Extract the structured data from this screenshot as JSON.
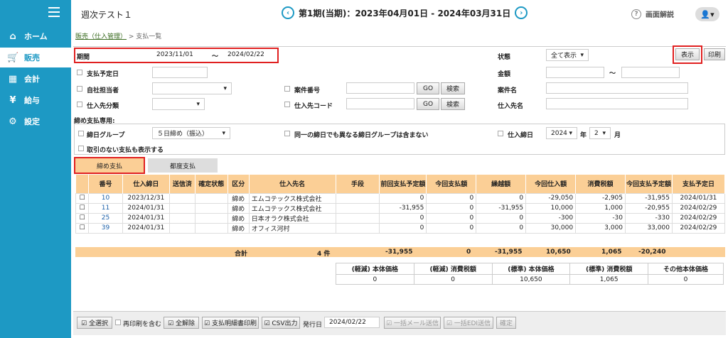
{
  "app": {
    "title": "週次テスト１"
  },
  "header": {
    "period": "第1期(当期)：2023年04月01日 - 2024年03月31日",
    "help": "画面解説",
    "prev": "‹",
    "next": "›"
  },
  "sidebar": {
    "items": [
      {
        "label": "ホーム",
        "icon": "⌂"
      },
      {
        "label": "販売",
        "icon": "🛒"
      },
      {
        "label": "会計",
        "icon": "▦"
      },
      {
        "label": "給与",
        "icon": "¥"
      },
      {
        "label": "設定",
        "icon": "⚙"
      }
    ]
  },
  "breadcrumb": {
    "parent": "販売（仕入管理）",
    "current": "> 支払一覧"
  },
  "filters": {
    "period_label": "期間",
    "date_from": "2023/11/01",
    "tilde": "〜",
    "date_to": "2024/02/22",
    "status_label": "状態",
    "status_value": "全て表示",
    "show_button": "表示",
    "print_button": "印刷",
    "pay_date_label": "支払予定日",
    "amount_label": "金額",
    "staff_label": "自社担当者",
    "case_no_label": "案件番号",
    "go": "GO",
    "search": "検索",
    "case_name_label": "案件名",
    "supplier_class_label": "仕入先分類",
    "supplier_code_label": "仕入先コード",
    "supplier_name_label": "仕入先名",
    "closing_only_label": "締め支払専用:",
    "closing_group_label": "締日グループ",
    "closing_group_value": "５日締め（振込）",
    "exclude_label": "同一の締日でも異なる締日グループは含まない",
    "closing_date_label": "仕入締日",
    "year_value": "2024",
    "year_unit": "年",
    "month_value": "2",
    "month_unit": "月",
    "no_trade_label": "取引のない支払も表示する"
  },
  "tabs": [
    {
      "label": "締め支払"
    },
    {
      "label": "都度支払"
    }
  ],
  "table": {
    "headers": [
      "番号",
      "仕入締日",
      "送信済",
      "確定状態",
      "区分",
      "仕入先名",
      "手段",
      "前回支払予定額",
      "今回支払額",
      "繰越額",
      "今回仕入額",
      "消費税額",
      "今回支払予定額",
      "支払予定日"
    ],
    "rows": [
      [
        "10",
        "2023/12/31",
        "",
        "",
        "締め",
        "エムコテックス株式会社",
        "",
        "0",
        "0",
        "0",
        "-29,050",
        "-2,905",
        "-31,955",
        "2024/01/31"
      ],
      [
        "11",
        "2024/01/31",
        "",
        "",
        "締め",
        "エムコテックス株式会社",
        "",
        "-31,955",
        "0",
        "-31,955",
        "10,000",
        "1,000",
        "-20,955",
        "2024/02/29"
      ],
      [
        "25",
        "2024/01/31",
        "",
        "",
        "締め",
        "日本オラク株式会社",
        "",
        "0",
        "0",
        "0",
        "-300",
        "-30",
        "-330",
        "2024/02/29"
      ],
      [
        "39",
        "2024/01/31",
        "",
        "",
        "締め",
        "オフィス河村",
        "",
        "0",
        "0",
        "0",
        "30,000",
        "3,000",
        "33,000",
        "2024/02/29"
      ]
    ],
    "total": {
      "label": "合計",
      "count": "4 件",
      "prev": "-31,955",
      "paid": "0",
      "carry": "-31,955",
      "purchase": "10,650",
      "tax": "1,065",
      "due": "-20,240"
    }
  },
  "tax_summary": {
    "headers": [
      "(軽減) 本体価格",
      "(軽減) 消費税額",
      "(標準) 本体価格",
      "(標準) 消費税額",
      "その他本体価格"
    ],
    "values": [
      "0",
      "0",
      "10,650",
      "1,065",
      "0"
    ]
  },
  "footer": {
    "select_all": "☑ 全選択",
    "include_printed": "再印刷を含む",
    "deselect_all": "☑ 全解除",
    "print_statement": "☑ 支払明細書印刷",
    "csv": "☑ CSV出力",
    "issue_date_label": "発行日",
    "issue_date": "2024/02/22",
    "bulk_mail": "☑ 一括メール送信",
    "bulk_edi": "☑ 一括EDI送信",
    "confirm": "確定"
  }
}
